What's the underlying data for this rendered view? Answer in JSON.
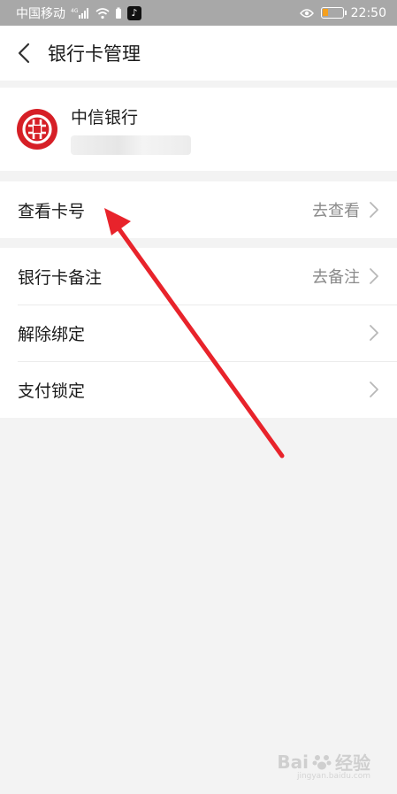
{
  "status_bar": {
    "carrier": "中国移动",
    "network": "4G",
    "time": "22:50",
    "battery_level": 0.25,
    "battery_color": "#f5a01e"
  },
  "header": {
    "back_icon": "chevron-left-icon",
    "title": "银行卡管理"
  },
  "bank": {
    "name": "中信银行",
    "logo_color": "#d61f26"
  },
  "menu_group_1": [
    {
      "label": "查看卡号",
      "action": "去查看"
    }
  ],
  "menu_group_2": [
    {
      "label": "银行卡备注",
      "action": "去备注"
    },
    {
      "label": "解除绑定",
      "action": ""
    },
    {
      "label": "支付锁定",
      "action": ""
    }
  ],
  "annotation": {
    "arrow_color": "#e8232b"
  },
  "watermark": {
    "brand": "Bai",
    "suffix": "经验",
    "url": "jingyan.baidu.com"
  }
}
